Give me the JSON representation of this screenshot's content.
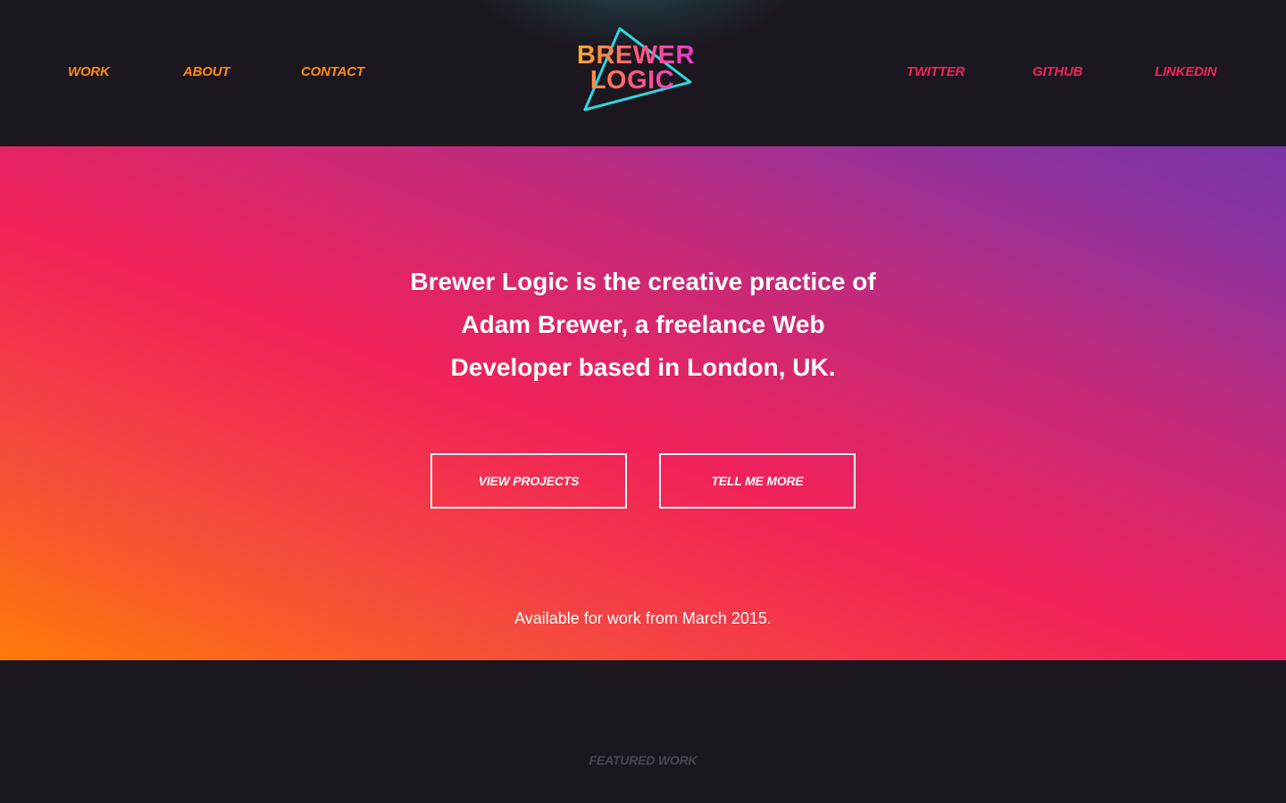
{
  "header": {
    "nav_left": [
      {
        "label": "WORK"
      },
      {
        "label": "ABOUT"
      },
      {
        "label": "CONTACT"
      }
    ],
    "nav_right": [
      {
        "label": "TWITTER"
      },
      {
        "label": "GITHUB"
      },
      {
        "label": "LINKEDIN"
      }
    ],
    "logo": {
      "line1": "BREWER",
      "line2": "LOGIC"
    }
  },
  "hero": {
    "intro_line1": "Brewer Logic is the creative practice of",
    "intro_line2": "Adam Brewer, a freelance Web",
    "intro_line3": "Developer based in London, UK.",
    "button_projects": "VIEW PROJECTS",
    "button_more": "TELL ME MORE",
    "availability": "Available for work from March 2015."
  },
  "featured": {
    "title": "FEATURED WORK"
  },
  "colors": {
    "background": "#1c171f",
    "nav_left": "#ff8a14",
    "nav_right": "#f0245a",
    "gradient_start": "#ff7a08",
    "gradient_mid": "#f22259",
    "gradient_end": "#7a34a6",
    "logo_triangle": "#2fd6e0"
  }
}
